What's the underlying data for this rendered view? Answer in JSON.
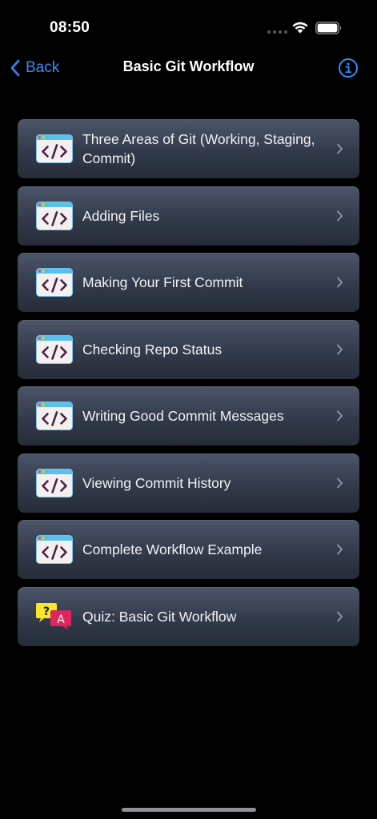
{
  "status_bar": {
    "time": "08:50"
  },
  "nav": {
    "back_label": "Back",
    "title": "Basic Git Workflow",
    "info_icon": "info-circle-icon"
  },
  "colors": {
    "accent": "#2f8df5",
    "card_top": "#4c5669",
    "card_bottom": "#262c38",
    "background": "#000000"
  },
  "lessons": [
    {
      "label": "Three Areas of Git (Working, Staging, Commit)",
      "icon": "code-window-icon"
    },
    {
      "label": "Adding Files",
      "icon": "code-window-icon"
    },
    {
      "label": "Making Your First Commit",
      "icon": "code-window-icon"
    },
    {
      "label": "Checking Repo Status",
      "icon": "code-window-icon"
    },
    {
      "label": "Writing Good Commit Messages",
      "icon": "code-window-icon"
    },
    {
      "label": "Viewing Commit History",
      "icon": "code-window-icon"
    },
    {
      "label": "Complete Workflow Example",
      "icon": "code-window-icon"
    },
    {
      "label": "Quiz: Basic Git Workflow",
      "icon": "quiz-bubbles-icon"
    }
  ]
}
